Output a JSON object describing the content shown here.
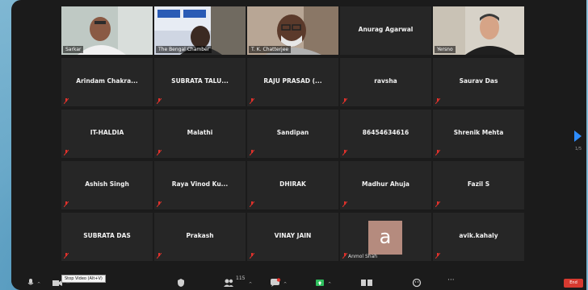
{
  "colors": {
    "accent": "#2d8cff",
    "mute": "#e0312b",
    "active_border": "#e2d34a",
    "end": "#d73a30"
  },
  "video_tiles": [
    {
      "label": "Sarkar"
    },
    {
      "label": "The Bengal Chamber"
    },
    {
      "label": "T. K. Chatterjee"
    },
    {
      "label": "Anurag Agarwal"
    },
    {
      "label": "Yersno"
    }
  ],
  "tiles": [
    {
      "name": "Arindam  Chakra..."
    },
    {
      "name": "SUBRATA TALU..."
    },
    {
      "name": "RAJU PRASAD (..."
    },
    {
      "name": "ravsha"
    },
    {
      "name": "Saurav Das"
    },
    {
      "name": "IT-HALDIA"
    },
    {
      "name": "Malathi"
    },
    {
      "name": "Sandipan"
    },
    {
      "name": "86454634616"
    },
    {
      "name": "Shrenik Mehta"
    },
    {
      "name": "Ashish Singh"
    },
    {
      "name": "Raya  Vinod  Ku..."
    },
    {
      "name": "DHIRAK"
    },
    {
      "name": "Madhur Ahuja"
    },
    {
      "name": "Fazil S"
    },
    {
      "name": "SUBRATA DAS"
    },
    {
      "name": "Prakash"
    },
    {
      "name": "VINAY JAIN"
    },
    {
      "name": "",
      "avatar": "a",
      "avatar_name": "Anmol Shah"
    },
    {
      "name": "avik.kahaly"
    }
  ],
  "pagination": {
    "indicator": "1/5"
  },
  "toolbar": {
    "tooltip": "Stop Video (Alt+V)",
    "participants_count": "115",
    "end_label": "End",
    "icons": [
      "microphone-icon",
      "video-icon",
      "security-icon",
      "participants-icon",
      "chat-icon",
      "share-screen-icon",
      "record-icon",
      "reactions-icon",
      "more-icon"
    ]
  }
}
